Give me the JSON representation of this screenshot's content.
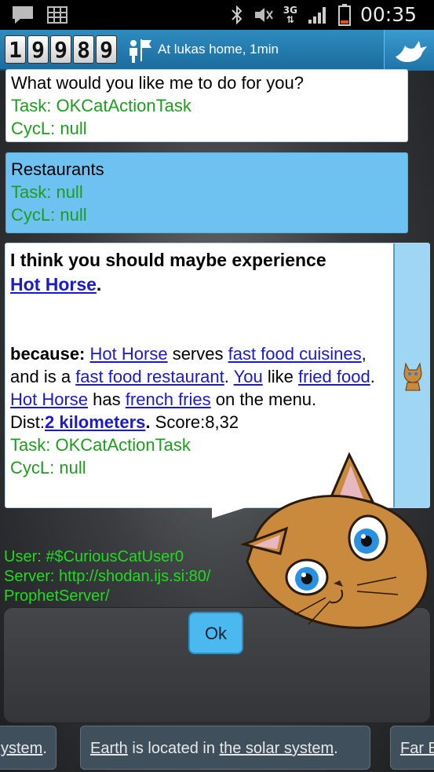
{
  "status_bar": {
    "network": "3G",
    "time": "00:35",
    "icons": [
      "message-icon",
      "grid-icon",
      "bluetooth-icon",
      "mute-icon",
      "signal-icon",
      "battery-icon"
    ]
  },
  "header": {
    "counter": [
      "1",
      "9",
      "9",
      "8",
      "9"
    ],
    "location": "At lukas home, 1min",
    "icons": [
      "people-icon",
      "share-bird-icon"
    ]
  },
  "messages": {
    "prompt": {
      "text": "What would you like me to do for you?",
      "task": "Task: OKCatActionTask",
      "cycl": "CycL: null"
    },
    "user_reply": {
      "text": "Restaurants",
      "task": "Task: null",
      "cycl": "CycL: null"
    },
    "suggestion": {
      "intro": "I think you should maybe experience",
      "place": "Hot Horse",
      "period": ".",
      "because_label": "because:",
      "place2": "Hot Horse",
      "serves": "serves",
      "fast_food": "fast food cuisines",
      "and_is_a": ", and is a",
      "fast_food_restaurant": "fast food restaurant",
      "dot1": ".",
      "you": "You",
      "like": "like",
      "fried_food": "fried food",
      "dot2": ".",
      "place3": "Hot Horse",
      "has": "has",
      "french_fries": "french fries",
      "on_menu": "on the menu.",
      "dist_label": "Dist:",
      "dist_value": "2 kilometers",
      "dist_dot": ".",
      "score": "Score:8,32",
      "task": "Task: OKCatActionTask",
      "cycl": "CycL: null"
    }
  },
  "user_info": {
    "user": "User: #$CuriousCatUser0",
    "server_line1": "Server: http://shodan.ijs.si:80/",
    "server_line2": "ProphetServer/"
  },
  "ok_label": "Ok",
  "ticker": {
    "left_fragment": "ystem",
    "left_dot": ".",
    "center_word1": "Earth",
    "center_middle": "is located in",
    "center_word2": "the solar system",
    "center_dot": ".",
    "right_fragment": "Far E"
  }
}
